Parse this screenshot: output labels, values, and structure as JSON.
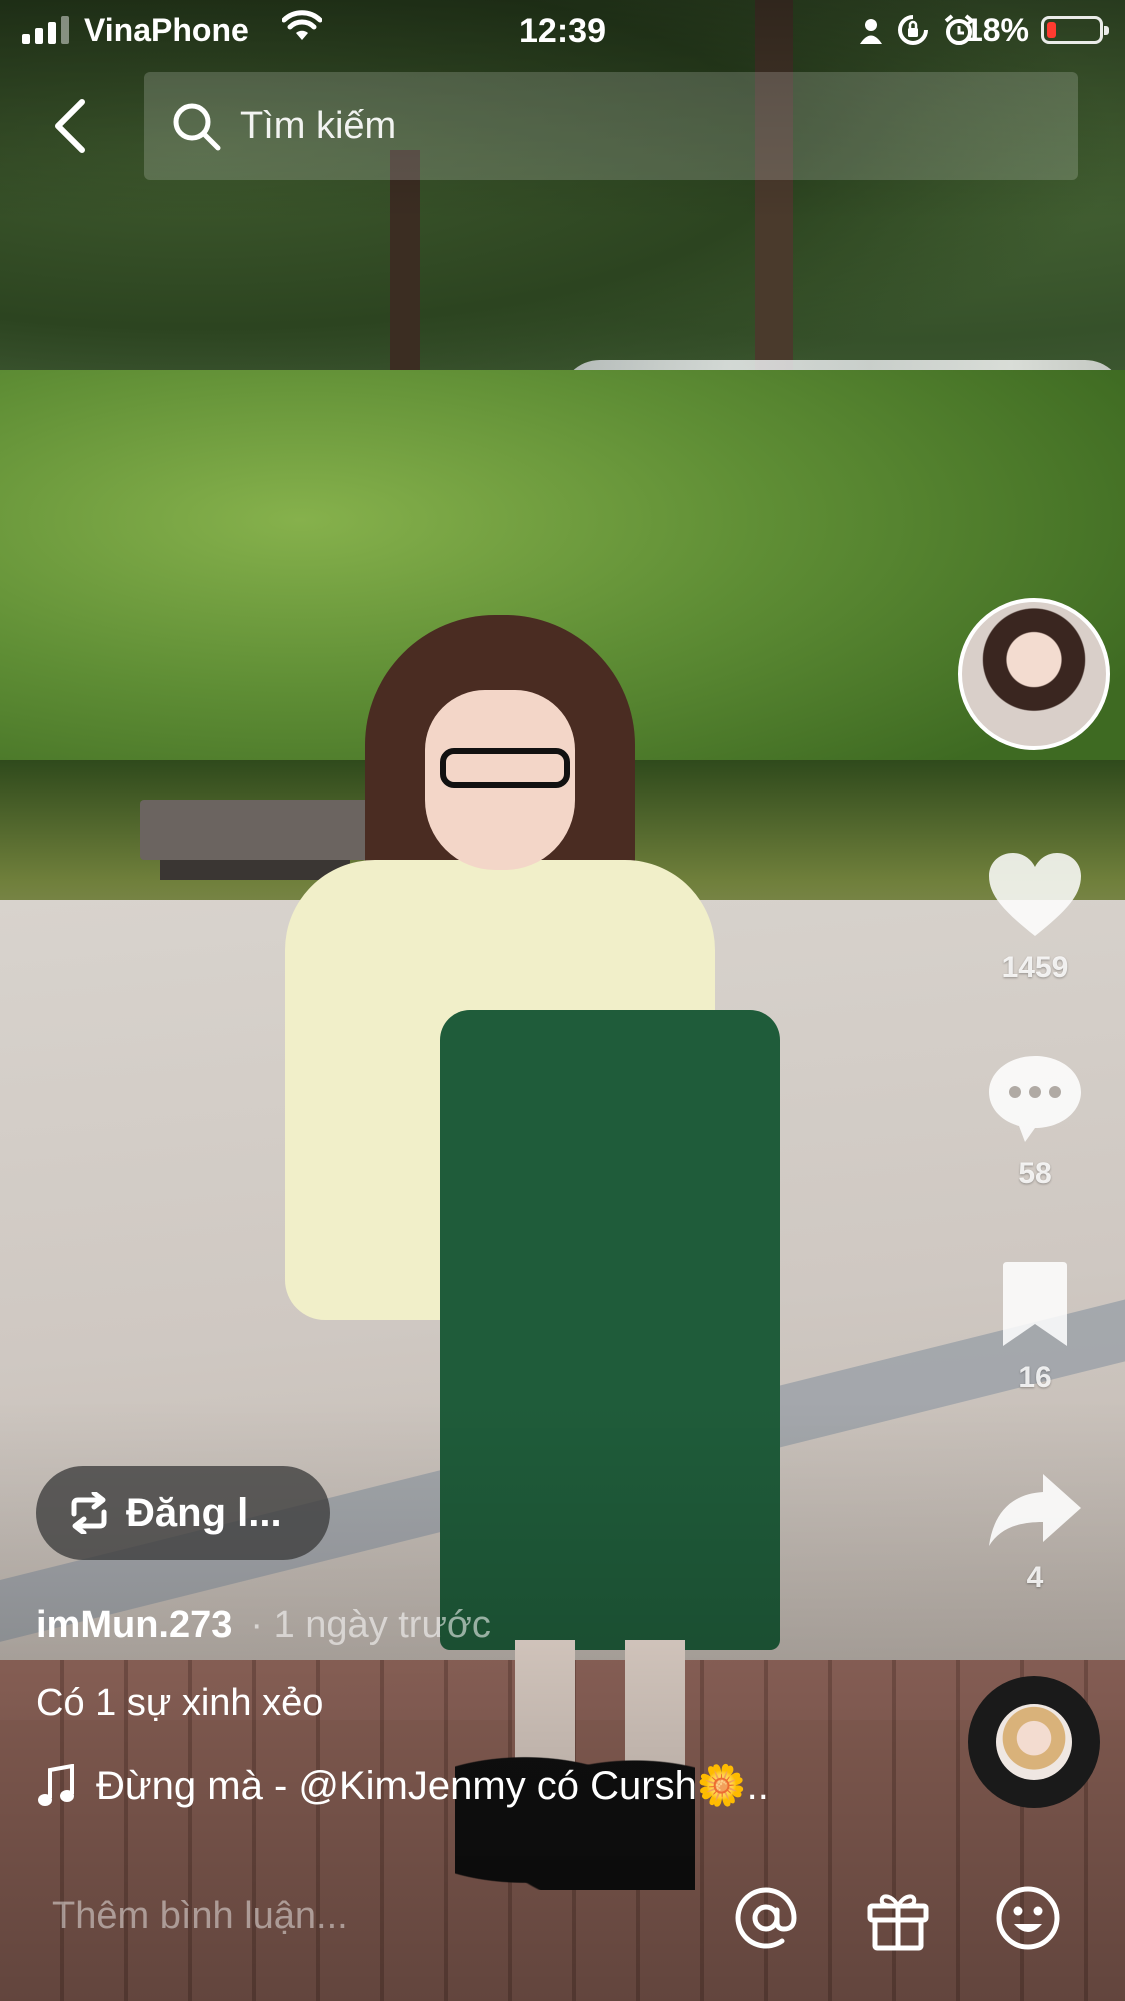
{
  "status_bar": {
    "carrier": "VinaPhone",
    "time": "12:39",
    "battery_percent": "18%",
    "battery_level": 0.18,
    "battery_color": "#ff3b30",
    "icons": [
      "signal-icon",
      "wifi-icon",
      "person-icon",
      "rotation-lock-icon",
      "alarm-icon",
      "battery-icon"
    ]
  },
  "header": {
    "search_placeholder": "Tìm kiếm"
  },
  "rail": {
    "likes": "1459",
    "comments": "58",
    "saves": "16",
    "shares": "4"
  },
  "post": {
    "repost_label": "Đăng l...",
    "author": "imMun.273",
    "time_ago": "· 1 ngày trước",
    "caption": "Có 1 sự xinh xẻo",
    "music": "Đừng mà - @KimJenmy có Cursh🌼.."
  },
  "comment_bar": {
    "placeholder": "Thêm bình luận..."
  }
}
